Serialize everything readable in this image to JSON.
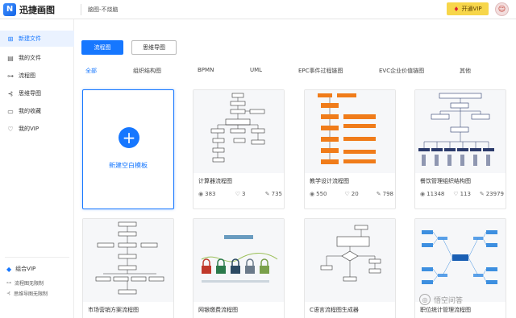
{
  "app": {
    "logo_glyph": "N",
    "name": "迅捷画图",
    "slogan": "脑图-不烧脑",
    "vip_button": "开通VIP",
    "avatar_glyph": "☺"
  },
  "sidebar": {
    "items": [
      {
        "label": "新建文件",
        "icon": "plus-square-icon",
        "glyph": "⊞"
      },
      {
        "label": "我的文件",
        "icon": "file-icon",
        "glyph": "▤"
      },
      {
        "label": "流程图",
        "icon": "flowchart-icon",
        "glyph": "⊶"
      },
      {
        "label": "思维导图",
        "icon": "mindmap-icon",
        "glyph": "⊰"
      },
      {
        "label": "我的收藏",
        "icon": "folder-icon",
        "glyph": "▭"
      },
      {
        "label": "我的VIP",
        "icon": "heart-icon",
        "glyph": "♡"
      }
    ],
    "combo_vip": {
      "label": "组合VIP",
      "glyph": "◆"
    },
    "subs": [
      {
        "label": "流程图无限制",
        "glyph": "⊶"
      },
      {
        "label": "思维导图无限制",
        "glyph": "⊰"
      }
    ]
  },
  "main": {
    "tabs": [
      {
        "label": "流程图",
        "active": true
      },
      {
        "label": "思维导图",
        "active": false
      }
    ],
    "categories": [
      "全部",
      "组织结构图",
      "BPMN",
      "UML",
      "EPC事件过程链图",
      "EVC企业价值链图",
      "其他"
    ],
    "blank_card": {
      "plus": "+",
      "label": "新建空白模板"
    },
    "cards": [
      {
        "title": "计算器流程图",
        "views": "383",
        "likes": "3",
        "uses": "735"
      },
      {
        "title": "教学设计流程图",
        "views": "550",
        "likes": "20",
        "uses": "798"
      },
      {
        "title": "餐饮管理组织结构图",
        "views": "11348",
        "likes": "113",
        "uses": "23979"
      },
      {
        "title": "市场营销方案流程图"
      },
      {
        "title": "网银缴费流程图"
      },
      {
        "title": "C语言流程图生成器"
      },
      {
        "title": "职位统计管理流程图"
      }
    ]
  },
  "watermark": {
    "glyph": "◎",
    "text": "悟空问答"
  },
  "colors": {
    "accent": "#1677ff",
    "vip": "#f7d64a",
    "orange": "#f07c1a",
    "navy": "#2b3a6b"
  }
}
